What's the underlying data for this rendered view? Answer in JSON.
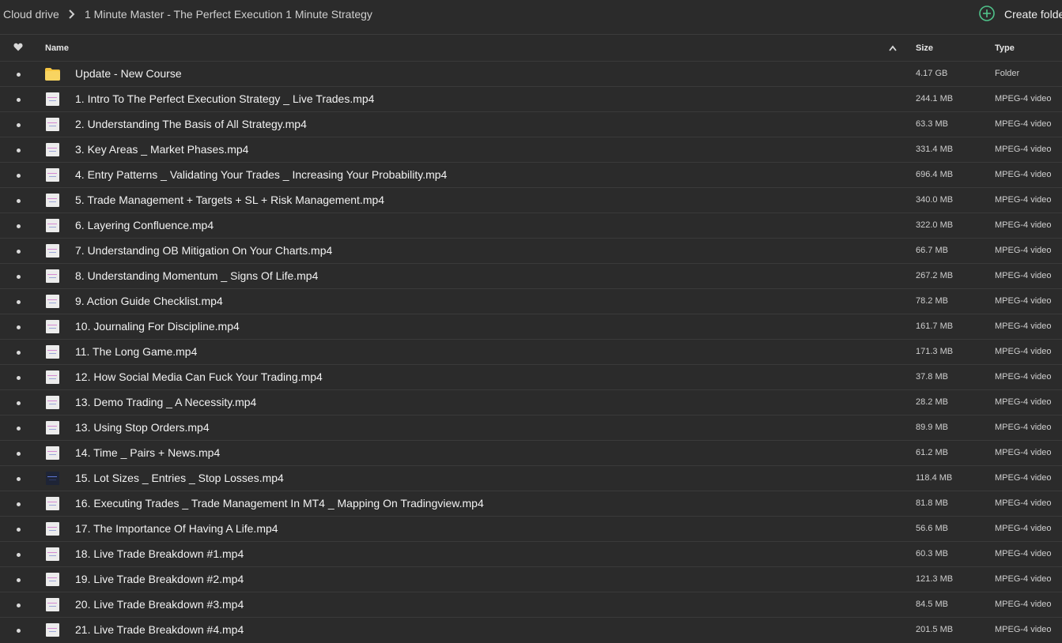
{
  "breadcrumb": {
    "root": "Cloud drive",
    "current": "1 Minute Master - The Perfect Execution 1 Minute Strategy"
  },
  "toolbar": {
    "create_folder_label": "Create folder"
  },
  "table": {
    "headers": {
      "name": "Name",
      "size": "Size",
      "type": "Type"
    },
    "rows": [
      {
        "name": "Update - New Course",
        "size": "4.17 GB",
        "type": "Folder",
        "kind": "folder"
      },
      {
        "name": "1. Intro To The Perfect Execution Strategy _ Live Trades.mp4",
        "size": "244.1 MB",
        "type": "MPEG-4 video",
        "kind": "video"
      },
      {
        "name": "2. Understanding The Basis of All Strategy.mp4",
        "size": "63.3 MB",
        "type": "MPEG-4 video",
        "kind": "video"
      },
      {
        "name": "3. Key Areas _ Market Phases.mp4",
        "size": "331.4 MB",
        "type": "MPEG-4 video",
        "kind": "video"
      },
      {
        "name": "4. Entry Patterns _ Validating Your Trades _ Increasing Your Probability.mp4",
        "size": "696.4 MB",
        "type": "MPEG-4 video",
        "kind": "video"
      },
      {
        "name": "5. Trade Management + Targets + SL + Risk Management.mp4",
        "size": "340.0 MB",
        "type": "MPEG-4 video",
        "kind": "video"
      },
      {
        "name": "6. Layering Confluence.mp4",
        "size": "322.0 MB",
        "type": "MPEG-4 video",
        "kind": "video"
      },
      {
        "name": "7. Understanding OB Mitigation On Your Charts.mp4",
        "size": "66.7 MB",
        "type": "MPEG-4 video",
        "kind": "video"
      },
      {
        "name": "8. Understanding Momentum _ Signs Of Life.mp4",
        "size": "267.2 MB",
        "type": "MPEG-4 video",
        "kind": "video"
      },
      {
        "name": "9. Action Guide Checklist.mp4",
        "size": "78.2 MB",
        "type": "MPEG-4 video",
        "kind": "video"
      },
      {
        "name": "10. Journaling For Discipline.mp4",
        "size": "161.7 MB",
        "type": "MPEG-4 video",
        "kind": "video"
      },
      {
        "name": "11. The Long Game.mp4",
        "size": "171.3 MB",
        "type": "MPEG-4 video",
        "kind": "video"
      },
      {
        "name": "12. How Social Media Can Fuck Your Trading.mp4",
        "size": "37.8 MB",
        "type": "MPEG-4 video",
        "kind": "video"
      },
      {
        "name": "13. Demo Trading _ A Necessity.mp4",
        "size": "28.2 MB",
        "type": "MPEG-4 video",
        "kind": "video"
      },
      {
        "name": "13. Using Stop Orders.mp4",
        "size": "89.9 MB",
        "type": "MPEG-4 video",
        "kind": "video"
      },
      {
        "name": "14. Time _ Pairs + News.mp4",
        "size": "61.2 MB",
        "type": "MPEG-4 video",
        "kind": "video"
      },
      {
        "name": "15. Lot Sizes _ Entries _ Stop Losses.mp4",
        "size": "118.4 MB",
        "type": "MPEG-4 video",
        "kind": "video-dark"
      },
      {
        "name": "16. Executing Trades _ Trade Management In MT4 _ Mapping On Tradingview.mp4",
        "size": "81.8 MB",
        "type": "MPEG-4 video",
        "kind": "video"
      },
      {
        "name": "17. The Importance Of Having A Life.mp4",
        "size": "56.6 MB",
        "type": "MPEG-4 video",
        "kind": "video"
      },
      {
        "name": "18. Live Trade Breakdown #1.mp4",
        "size": "60.3 MB",
        "type": "MPEG-4 video",
        "kind": "video"
      },
      {
        "name": "19. Live Trade Breakdown #2.mp4",
        "size": "121.3 MB",
        "type": "MPEG-4 video",
        "kind": "video"
      },
      {
        "name": "20. Live Trade Breakdown #3.mp4",
        "size": "84.5 MB",
        "type": "MPEG-4 video",
        "kind": "video"
      },
      {
        "name": "21. Live Trade Breakdown #4.mp4",
        "size": "201.5 MB",
        "type": "MPEG-4 video",
        "kind": "video"
      }
    ]
  },
  "colors": {
    "background": "#2b2b2b",
    "accent_green": "#4fc28a",
    "folder_yellow": "#f5c542"
  },
  "icons": [
    "chevron-right-icon",
    "plus-circle-icon",
    "heart-icon",
    "sort-ascending-icon",
    "folder-icon",
    "video-thumbnail-icon"
  ]
}
